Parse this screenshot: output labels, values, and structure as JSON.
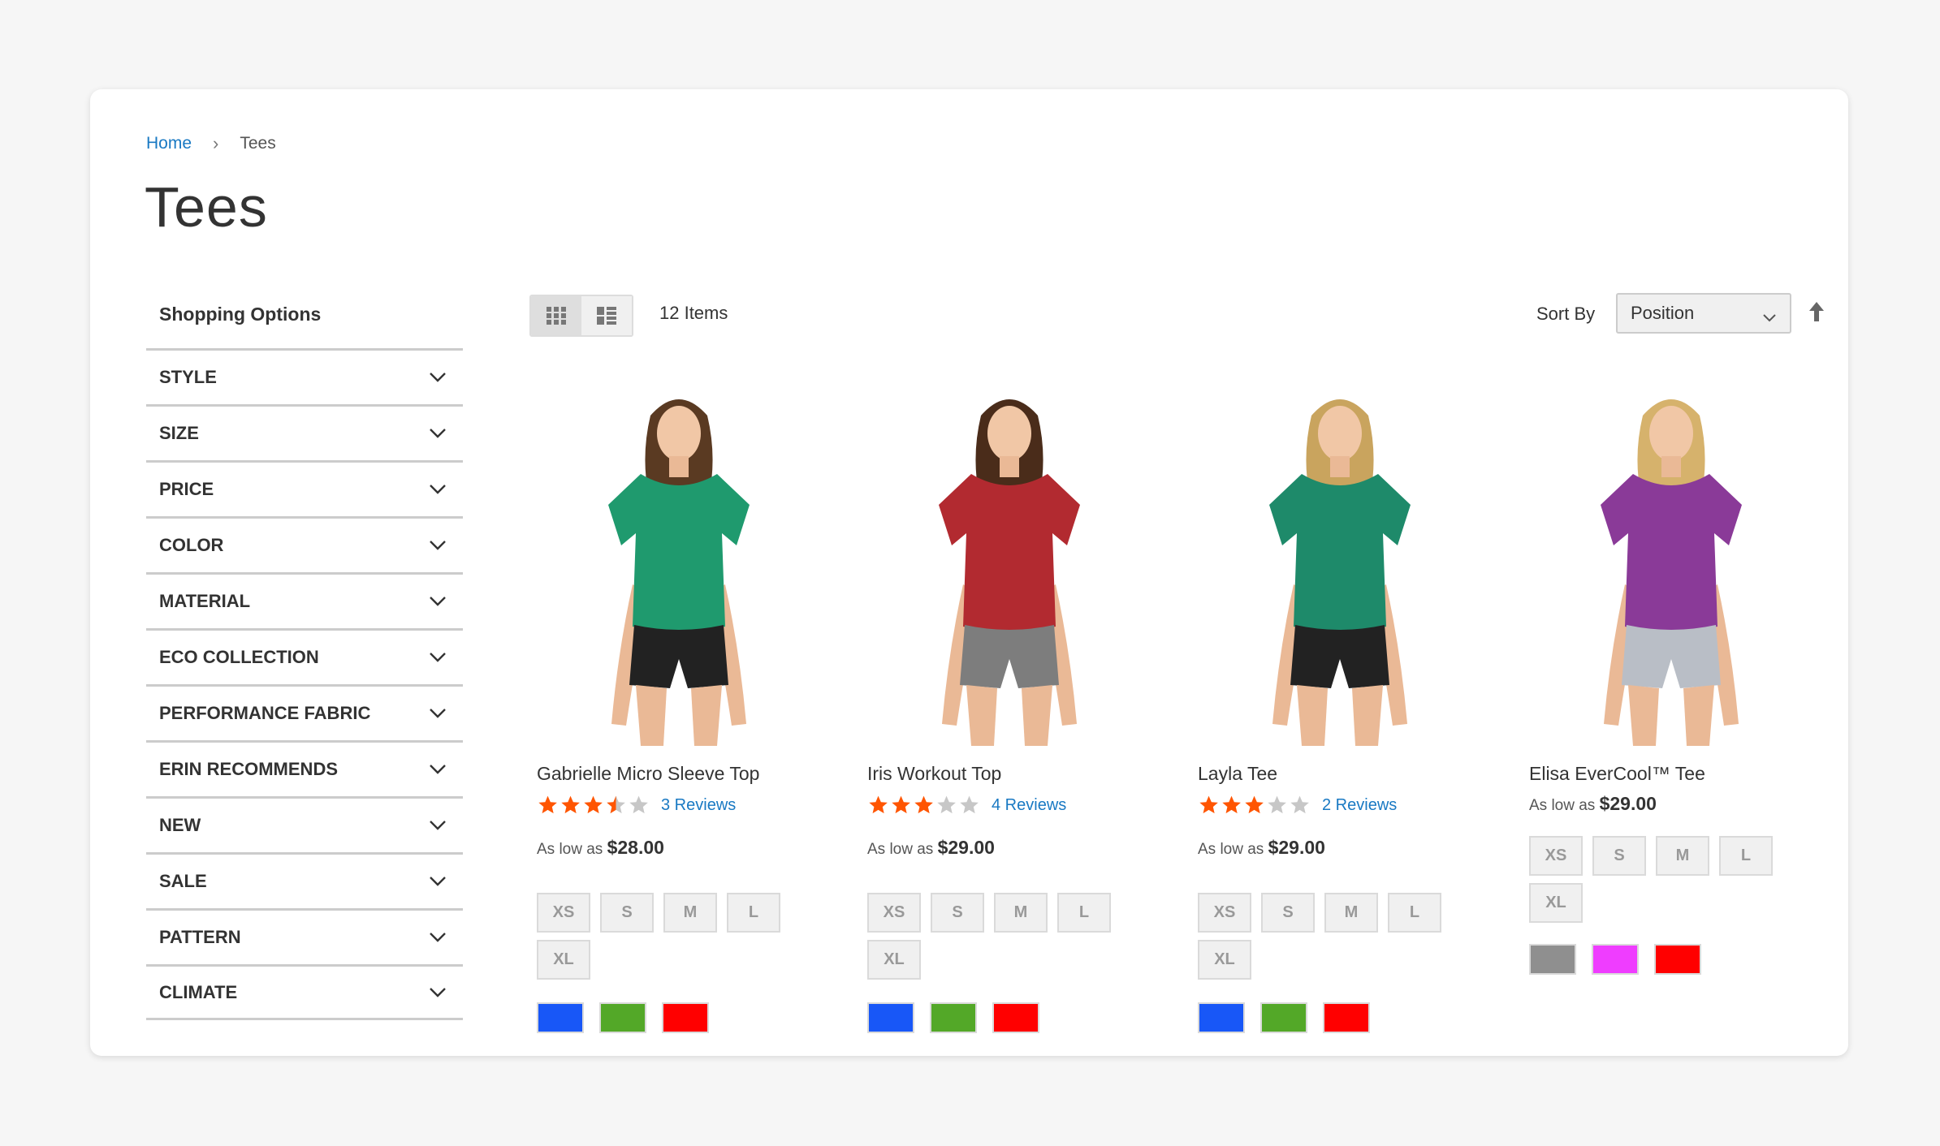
{
  "breadcrumb": {
    "home": "Home",
    "separator": "›",
    "current": "Tees"
  },
  "page_title": "Tees",
  "sidebar": {
    "title": "Shopping Options",
    "filters": [
      "STYLE",
      "SIZE",
      "PRICE",
      "COLOR",
      "MATERIAL",
      "ECO COLLECTION",
      "PERFORMANCE FABRIC",
      "ERIN RECOMMENDS",
      "NEW",
      "SALE",
      "PATTERN",
      "CLIMATE"
    ]
  },
  "toolbar": {
    "views": [
      "grid-icon",
      "list-icon"
    ],
    "active_view": "grid",
    "item_count": "12 Items",
    "sort_label": "Sort By",
    "sort_value": "Position",
    "sort_direction": "arrow-up-icon"
  },
  "colors": {
    "link": "#1979c3",
    "star_on": "#ff5501",
    "star_off": "#c7c7c7"
  },
  "products": [
    {
      "name": "Gabrielle Micro Sleeve Top",
      "rating": 3.5,
      "reviews": "3  Reviews",
      "price_prefix": "As low as",
      "price": "$28.00",
      "sizes": [
        "XS",
        "S",
        "M",
        "L",
        "XL"
      ],
      "swatches": [
        "#1857f7",
        "#53a828",
        "#ff0000"
      ],
      "shirt": "#1f9a6e",
      "bottom": "#222222",
      "hair": "#5a3a22"
    },
    {
      "name": "Iris Workout Top",
      "rating": 3,
      "reviews": "4  Reviews",
      "price_prefix": "As low as",
      "price": "$29.00",
      "sizes": [
        "XS",
        "S",
        "M",
        "L",
        "XL"
      ],
      "swatches": [
        "#1857f7",
        "#53a828",
        "#ff0000"
      ],
      "shirt": "#b22a30",
      "bottom": "#7d7d7d",
      "hair": "#4a2c1a"
    },
    {
      "name": "Layla Tee",
      "rating": 3,
      "reviews": "2  Reviews",
      "price_prefix": "As low as",
      "price": "$29.00",
      "sizes": [
        "XS",
        "S",
        "M",
        "L",
        "XL"
      ],
      "swatches": [
        "#1857f7",
        "#53a828",
        "#ff0000"
      ],
      "shirt": "#1e8a6a",
      "bottom": "#222222",
      "hair": "#c9a45e"
    },
    {
      "name": "Elisa EverCool™ Tee",
      "rating": 0,
      "reviews": "",
      "price_prefix": "As low as",
      "price": "$29.00",
      "sizes": [
        "XS",
        "S",
        "M",
        "L",
        "XL"
      ],
      "swatches": [
        "#8f8f8f",
        "#ef3dff",
        "#ff0000"
      ],
      "shirt": "#8a3a98",
      "bottom": "#b9bec6",
      "hair": "#d6b26c"
    }
  ]
}
